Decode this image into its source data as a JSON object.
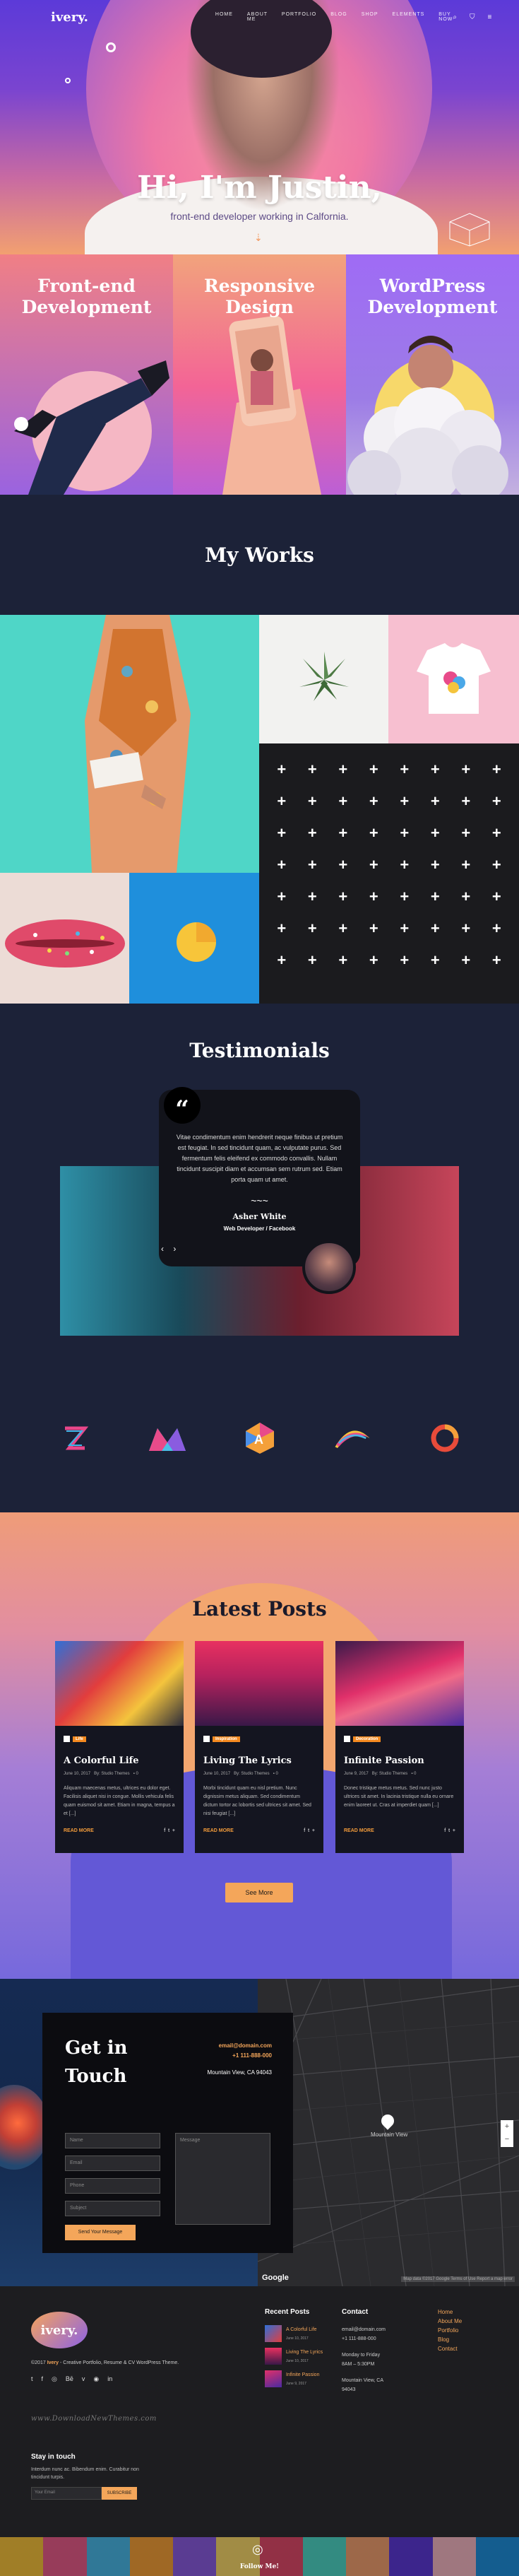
{
  "brand": {
    "logo": "ivery."
  },
  "nav": {
    "links": [
      "HOME",
      "ABOUT ME",
      "PORTFOLIO",
      "BLOG",
      "SHOP",
      "ELEMENTS",
      "BUY NOW"
    ],
    "icons": [
      "search-icon",
      "cart-icon",
      "menu-icon"
    ]
  },
  "hero": {
    "title": "Hi, I'm Justin,",
    "subtitle": "front-end developer working in Calfornia.",
    "arrow": "⇣"
  },
  "services": [
    {
      "line1": "Front-end",
      "line2": "Development"
    },
    {
      "line1": "Responsive",
      "line2": "Design"
    },
    {
      "line1": "WordPress",
      "line2": "Development"
    }
  ],
  "works": {
    "title": "My Works"
  },
  "testimonials": {
    "title": "Testimonials",
    "quote_mark": "“",
    "text": "Vitae condimentum enim hendrerit neque finibus ut pretium est feugiat. In sed tincidunt quam, ac vulputate purus. Sed fermentum felis eleifend ex commodo convallis. Nullam tincidunt suscipit diam et accumsan sem rutrum sed. Etiam porta quam ut amet.",
    "squiggle": "~~~",
    "name": "Asher White",
    "role": "Web Developer / Facebook",
    "prev": "‹",
    "next": "›"
  },
  "brands": [
    "z-brand-logo",
    "m-brand-logo",
    "a-brand-logo",
    "wave-brand-logo",
    "ring-brand-logo"
  ],
  "posts": {
    "title": "Latest Posts",
    "items": [
      {
        "category": "Life",
        "title": "A Colorful Life",
        "date": "June 10, 2017",
        "author": "By: Studio Themes",
        "comments": "0",
        "excerpt": "Aliquam maecenas metus, ultrices eu dolor eget. Facilisis aliquet nisi in congue. Mollis vehicula felis quam euismod sit amet. Etiam in magna, tempus a et [...]",
        "read_more": "READ MORE"
      },
      {
        "category": "Inspiration",
        "title": "Living The Lyrics",
        "date": "June 10, 2017",
        "author": "By: Studio Themes",
        "comments": "0",
        "excerpt": "Morbi tincidunt quam eu nisl pretium. Nunc dignissim metus aliquam. Sed condimentum dictum tortor ac lobortis sed ultrices sit amet. Sed nisi feugiat [...]",
        "read_more": "READ MORE"
      },
      {
        "category": "Decoration",
        "title": "Infinite Passion",
        "date": "June 9, 2017",
        "author": "By: Studio Themes",
        "comments": "0",
        "excerpt": "Donec tristique metus metus. Sed nunc justo ultrices sit amet. In lacinia tristique nulla eu ornare enim laoreet ut. Cras at imperdiet quam [...]",
        "read_more": "READ MORE"
      }
    ],
    "see_more": "See More"
  },
  "contact": {
    "title_line1": "Get in",
    "title_line2": "Touch",
    "email": "email@domain.com",
    "phone": "+1 111-888-000",
    "address": "Mountain View, CA 94043",
    "fields": [
      "Name",
      "Email",
      "Phone",
      "Subject"
    ],
    "message_placeholder": "Message",
    "send": "Send Your Message",
    "map_label": "Mountain View",
    "google": "Google",
    "map_terms": "Map data ©2017 Google  Terms of Use  Report a map error"
  },
  "footer": {
    "logo": "ivery.",
    "copyright_prefix": "©2017 ",
    "copyright_brand": "Ivery",
    "copyright_suffix": " - Creative Portfolio, Resume & CV WordPress Theme.",
    "socials": [
      "twitter-icon",
      "facebook-icon",
      "instagram-icon",
      "behance-icon",
      "vimeo-icon",
      "dribbble-icon",
      "linkedin-icon"
    ],
    "watermark": "www.DownloadNewThemes.com",
    "stay_title": "Stay in touch",
    "stay_sub": "Interdum nunc ac. Bibendum enim. Curabitur non tincidunt turpis.",
    "subscribe_placeholder": "Your Email",
    "subscribe_btn": "SUBSCRIBE",
    "recent_title": "Recent Posts",
    "recent": [
      {
        "title": "A Colorful Life",
        "date": "June 10, 2017"
      },
      {
        "title": "Living The Lyrics",
        "date": "June 10, 2017"
      },
      {
        "title": "Infinite Passion",
        "date": "June 9, 2017"
      }
    ],
    "contact_title": "Contact",
    "contact_email": "email@domain.com",
    "contact_phone": "+1 111-888-000",
    "hours_line1": "Monday to Friday",
    "hours_line2": "8AM – 5:30PM",
    "address_line1": "Mountain View, CA",
    "address_line2": "94043",
    "links": [
      "Home",
      "About Me",
      "Portfolio",
      "Blog",
      "Contact"
    ],
    "instagram_label": "Follow Me!"
  },
  "colors": {
    "accent": "#f4a65a",
    "dark": "#1c2238",
    "footer": "#1d1d20"
  }
}
